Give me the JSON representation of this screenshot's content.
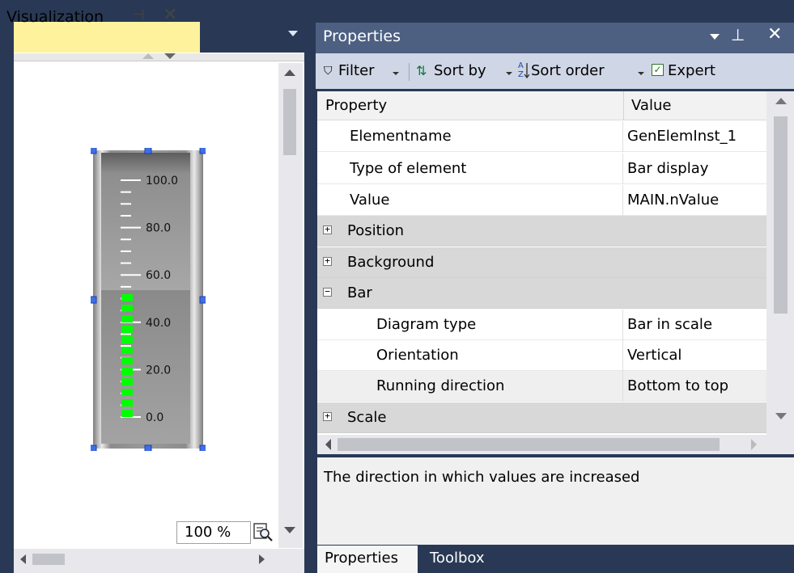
{
  "visualization": {
    "tab_title": "Visualization",
    "pin_glyph": "⊣",
    "close_glyph": "✕",
    "zoom": "100 %",
    "bar_display": {
      "scale_labels": [
        "100.0",
        "80.0",
        "60.0",
        "40.0",
        "20.0",
        "0.0"
      ],
      "scale_min": 0,
      "scale_max": 100,
      "value_fraction": 0.52,
      "bar_color": "#00ff00"
    }
  },
  "properties": {
    "title": "Properties",
    "pin_glyph": "⊥",
    "close_glyph": "✕",
    "toolbar": {
      "filter": "Filter",
      "sort_by": "Sort by",
      "sort_order": "Sort order",
      "expert": "Expert",
      "expert_checked": "✓"
    },
    "grid": {
      "col_property": "Property",
      "col_value": "Value",
      "rows": [
        {
          "name": "Elementname",
          "value": "GenElemInst_1"
        },
        {
          "name": "Type of element",
          "value": "Bar display"
        },
        {
          "name": "Value",
          "value": "MAIN.nValue"
        },
        {
          "name": "Position",
          "expander": "+"
        },
        {
          "name": "Background",
          "expander": "+"
        },
        {
          "name": "Bar",
          "expander": "−"
        },
        {
          "name": "Diagram type",
          "value": "Bar in scale"
        },
        {
          "name": "Orientation",
          "value": "Vertical"
        },
        {
          "name": "Running direction",
          "value": "Bottom to top"
        },
        {
          "name": "Scale",
          "expander": "+"
        }
      ]
    },
    "description": "The direction in which values are increased",
    "tabs": [
      "Properties",
      "Toolbox"
    ]
  },
  "colors": {
    "ide_background": "#293955",
    "active_tab": "#fff29d",
    "panel_header": "#4d6082"
  }
}
